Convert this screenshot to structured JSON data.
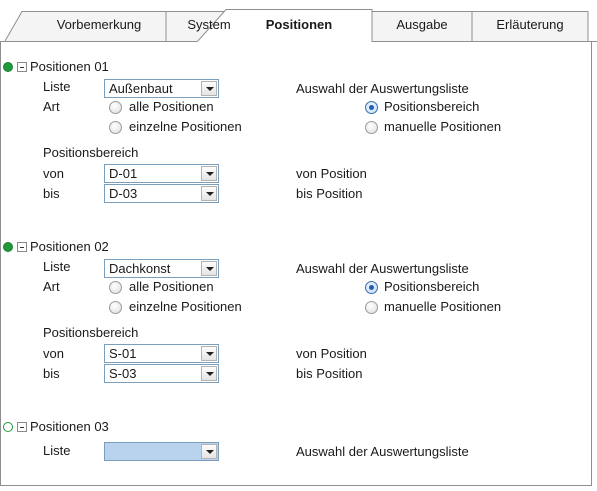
{
  "tabs": [
    {
      "label": "Vorbemerkung",
      "active": false
    },
    {
      "label": "System",
      "active": false
    },
    {
      "label": "Positionen",
      "active": true
    },
    {
      "label": "Ausgabe",
      "active": false
    },
    {
      "label": "Erläuterung",
      "active": false
    }
  ],
  "labels": {
    "liste": "Liste",
    "art": "Art",
    "auswahl_liste": "Auswahl der Auswertungsliste",
    "alle_positionen": "alle Positionen",
    "einzelne_positionen": "einzelne Positionen",
    "positionsbereich_option": "Positionsbereich",
    "manuelle_positionen": "manuelle Positionen",
    "positionsbereich_heading": "Positionsbereich",
    "von": "von",
    "bis": "bis",
    "von_position": "von Position",
    "bis_position": "bis Position"
  },
  "groups": [
    {
      "title": "Positionen 01",
      "status": "filled",
      "liste_value": "Außenbaut",
      "art_selected": "none",
      "auswahl_selected": "positionsbereich",
      "von_value": "D-01",
      "bis_value": "D-03"
    },
    {
      "title": "Positionen 02",
      "status": "filled",
      "liste_value": "Dachkonst",
      "art_selected": "none",
      "auswahl_selected": "positionsbereich",
      "von_value": "S-01",
      "bis_value": "S-03"
    },
    {
      "title": "Positionen 03",
      "status": "empty",
      "liste_value": ""
    }
  ],
  "colors": {
    "status_green": "#1f9a3a",
    "empty_combo_fill": "#b9d3ef",
    "tab_border": "#8e8f8f"
  }
}
